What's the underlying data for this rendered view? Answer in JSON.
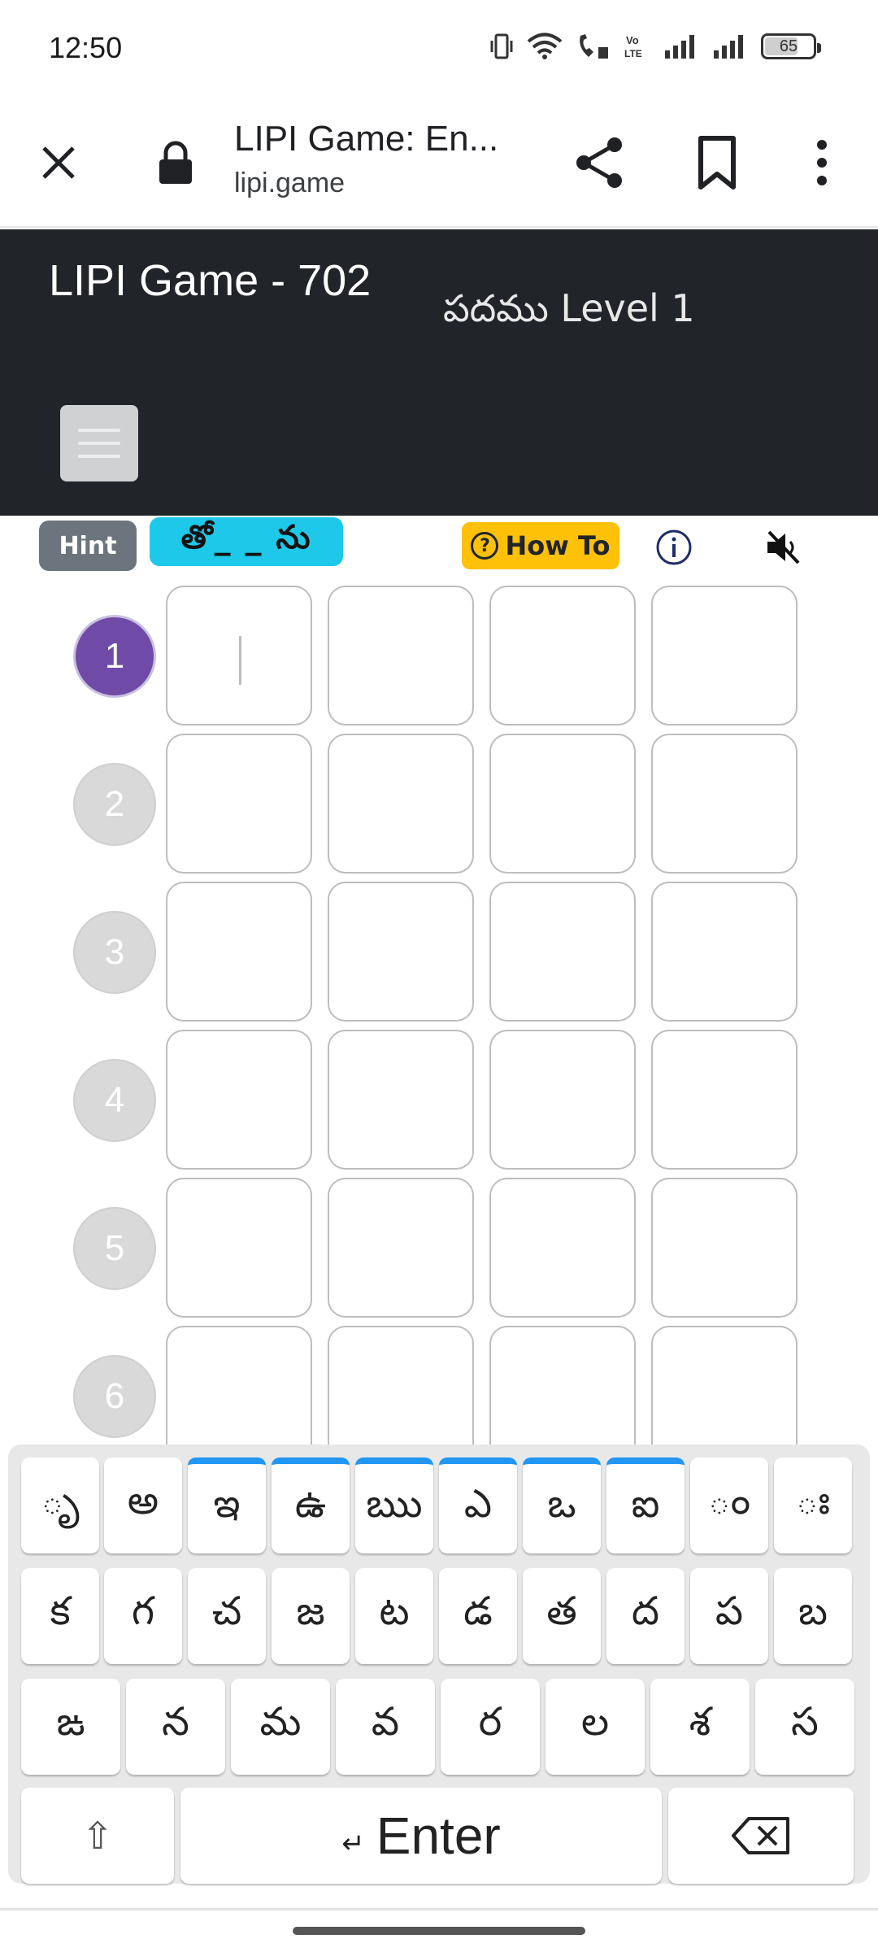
{
  "status_bar": {
    "time": "12:50",
    "battery": "65",
    "battery_level": 0.65
  },
  "browser": {
    "title": "LIPI Game: En...",
    "url": "lipi.game"
  },
  "header": {
    "title": "LIPI Game - 702",
    "level": "పదము Level 1"
  },
  "controls": {
    "hint_label": "Hint",
    "hint_value": "తో_ _ ను",
    "howto_label": "How To",
    "howto_icon": "?"
  },
  "grid": {
    "rows": [
      "1",
      "2",
      "3",
      "4",
      "5",
      "6"
    ],
    "active_row": "1",
    "columns": 4
  },
  "keyboard": {
    "row1": [
      "ృ",
      "అ",
      "ఇ",
      "ఉ",
      "ఋ",
      "ఎ",
      "ఒ",
      "ఐ",
      "ం",
      "ః"
    ],
    "row2": [
      "క",
      "గ",
      "చ",
      "జ",
      "ట",
      "డ",
      "త",
      "ద",
      "ప",
      "బ"
    ],
    "row3": [
      "ఙ",
      "న",
      "మ",
      "వ",
      "ర",
      "ల",
      "శ",
      "స"
    ],
    "shift": "⇧",
    "enter": "Enter",
    "enter_symbol": "↵",
    "accent_color": "#2196f3"
  },
  "colors": {
    "header_bg": "#212529",
    "active_row": "#6f4aa6",
    "hint_badge": "#1ec8e8",
    "howto": "#ffc107"
  }
}
